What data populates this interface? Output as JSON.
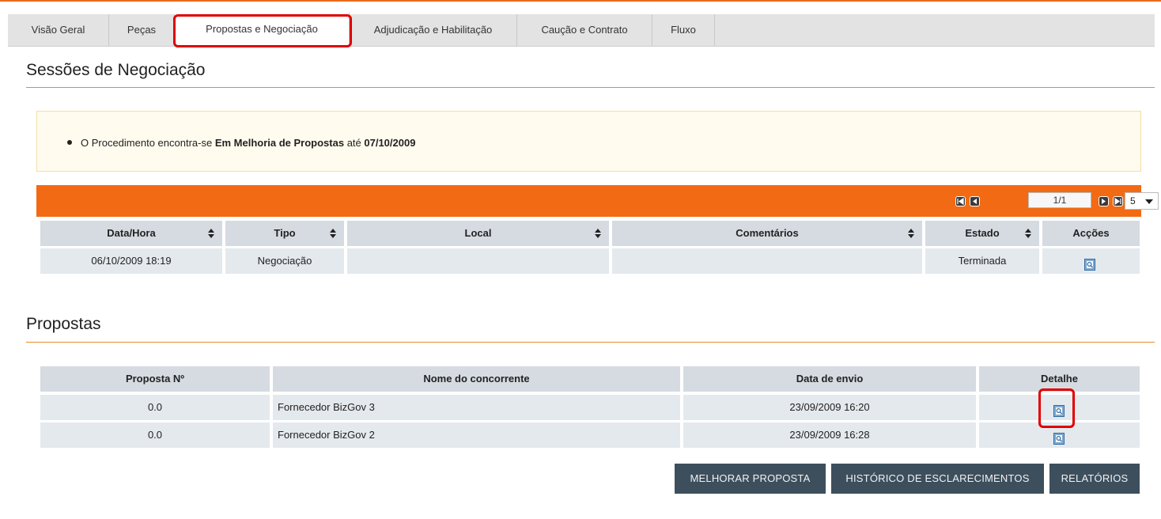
{
  "tabs": [
    {
      "label": "Visão Geral",
      "active": false
    },
    {
      "label": "Peças",
      "active": false
    },
    {
      "label": "Propostas e Negociação",
      "active": true
    },
    {
      "label": "Adjudicação e Habilitação",
      "active": false
    },
    {
      "label": "Caução e Contrato",
      "active": false
    },
    {
      "label": "Fluxo",
      "active": false
    }
  ],
  "sessions": {
    "title": "Sessões de Negociação",
    "notice": {
      "prefix": "O Procedimento encontra-se ",
      "state": "Em Melhoria de Propostas",
      "middle": " até ",
      "date": "07/10/2009"
    },
    "pager": {
      "page": "1/1",
      "page_size": "5"
    },
    "columns": [
      "Data/Hora",
      "Tipo",
      "Local",
      "Comentários",
      "Estado",
      "Acções"
    ],
    "rows": [
      {
        "data_hora": "06/10/2009 18:19",
        "tipo": "Negociação",
        "local": "",
        "comentarios": "",
        "estado": "Terminada",
        "accoes_icon": "view-details-icon"
      }
    ]
  },
  "proposals": {
    "title": "Propostas",
    "columns": [
      "Proposta Nº",
      "Nome do concorrente",
      "Data de envio",
      "Detalhe"
    ],
    "rows": [
      {
        "numero": "0.0",
        "concorrente": "Fornecedor BizGov 3",
        "data_envio": "23/09/2009 16:20",
        "detalhe_icon": "view-details-icon"
      },
      {
        "numero": "0.0",
        "concorrente": "Fornecedor BizGov 2",
        "data_envio": "23/09/2009 16:28",
        "detalhe_icon": "view-details-icon"
      }
    ]
  },
  "actions": {
    "improve": "MELHORAR PROPOSTA",
    "history": "HISTÓRICO DE ESCLARECIMENTOS",
    "reports": "RELATÓRIOS"
  },
  "colors": {
    "accent_orange": "#f26a14",
    "header_gray": "#d5dbe1",
    "row_gray": "#e4e9ed",
    "button_dark": "#3d4f5d",
    "highlight_red": "#e00000"
  }
}
